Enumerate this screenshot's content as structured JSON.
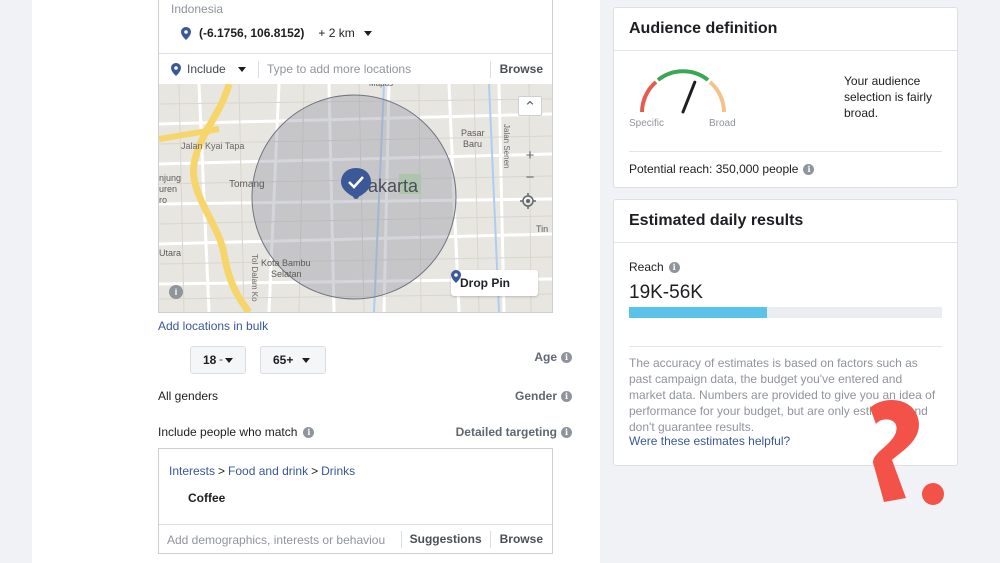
{
  "location": {
    "country": "Indonesia",
    "coordinates": "(-6.1756, 106.8152)",
    "radius": "+ 2 km",
    "include_label": "Include",
    "input_placeholder": "Type to add more locations",
    "browse_label": "Browse"
  },
  "map": {
    "city_label": "Jakarta",
    "place_labels": [
      "Jalan Kyai Tapa",
      "Tomang",
      "Kota Bambu Selatan",
      "Pasar Baru",
      "Mapus",
      "Jalan Senen",
      "njung",
      "uren",
      "ro",
      "Utara",
      "Tol Dalam Ko",
      "Tin"
    ],
    "drop_pin_label": "Drop Pin",
    "zoom_in": "+",
    "zoom_out": "−",
    "scroll_up": "⌃",
    "info": "i"
  },
  "bulk_link": "Add locations in bulk",
  "age": {
    "label": "Age",
    "min": "18",
    "separator": "-",
    "max": "65+"
  },
  "gender": {
    "label": "Gender",
    "value": "All genders"
  },
  "detailed": {
    "label": "Detailed targeting",
    "instruction": "Include people who match",
    "breadcrumb": [
      "Interests",
      "Food and drink",
      "Drinks"
    ],
    "crumb_sep": ">",
    "interest": "Coffee",
    "input_placeholder": "Add demographics, interests or behaviou",
    "suggestions_label": "Suggestions",
    "browse_label": "Browse"
  },
  "audience": {
    "title": "Audience definition",
    "gauge_left": "Specific",
    "gauge_right": "Broad",
    "description": "Your audience selection is fairly broad.",
    "potential_reach": "Potential reach: 350,000 people",
    "gauge_level": 0.62
  },
  "estimates": {
    "title": "Estimated daily results",
    "reach_label": "Reach",
    "reach_value": "19K-56K",
    "reach_bar_level": 0.44,
    "disclaimer": "The accuracy of estimates is based on factors such as past campaign data, the budget you've entered and market data. Numbers are provided to give you an idea of performance for your budget, but are only estimates and don't guarantee results.",
    "helpful_link": "Were these estimates helpful?"
  },
  "colors": {
    "link": "#385898",
    "reach_bar": "#5bc3e9",
    "brand_mark": "#f25248",
    "pin": "#3b5998"
  }
}
